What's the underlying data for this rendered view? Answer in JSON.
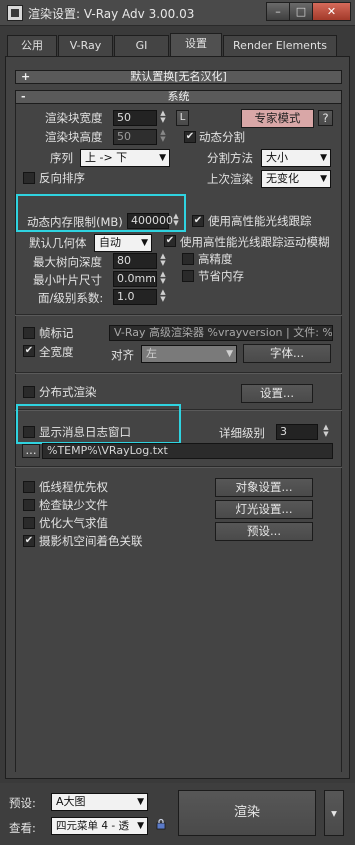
{
  "window": {
    "title": "渲染设置: V-Ray Adv 3.00.03",
    "minimize": "–",
    "maximize": "□",
    "close": "✕"
  },
  "tabs": [
    {
      "label": "公用"
    },
    {
      "label": "V-Ray"
    },
    {
      "label": "GI"
    },
    {
      "label": "设置"
    },
    {
      "label": "Render Elements"
    }
  ],
  "rollouts": {
    "default_replace": {
      "sign": "+",
      "title": "默认置换[无名汉化]"
    },
    "system": {
      "sign": "-",
      "title": "系统"
    }
  },
  "system": {
    "bucket_width_label": "渲染块宽度",
    "bucket_width_value": "50",
    "lock_label": "L",
    "expert_mode_label": "专家模式",
    "help_label": "?",
    "bucket_height_label": "渲染块高度",
    "bucket_height_value": "50",
    "dynamic_split_label": "动态分割",
    "sequence_label": "序列",
    "sequence_value": "上 -> 下",
    "split_method_label": "分割方法",
    "split_method_value": "大小",
    "reverse_order_label": "反向排序",
    "last_render_label": "上次渲染",
    "last_render_value": "无变化",
    "dynamic_memory_label": "动态内存限制(MB)",
    "dynamic_memory_value": "400000",
    "use_embree_label": "使用高性能光线跟踪",
    "default_geometry_label": "默认几何体",
    "default_geometry_value": "自动",
    "use_embree_motion_label": "使用高性能光线跟踪运动模糊",
    "max_tree_depth_label": "最大树向深度",
    "max_tree_depth_value": "80",
    "high_precision_label": "高精度",
    "min_leaf_size_label": "最小叶片尺寸",
    "min_leaf_size_value": "0.0mm",
    "save_memory_label": "节省内存",
    "face_level_coef_label": "面/级别系数:",
    "face_level_coef_value": "1.0",
    "frame_stamp_label": "帧标记",
    "frame_stamp_text": "V-Ray 高级渲染器 %vrayversion | 文件: %f",
    "full_width_label": "全宽度",
    "align_label": "对齐",
    "align_value": "左",
    "font_button": "字体...",
    "distributed_label": "分布式渲染",
    "distributed_settings_button": "设置...",
    "show_log_label": "显示消息日志窗口",
    "verbose_level_label": "详细级别",
    "verbose_level_value": "3",
    "log_browse": "...",
    "log_path": "%TEMP%\\VRayLog.txt",
    "low_thread_priority_label": "低线程优先权",
    "check_missing_files_label": "检查缺少文件",
    "optimize_atmo_label": "优化大气求值",
    "camera_space_shading_label": "摄影机空间着色关联",
    "object_settings_button": "对象设置...",
    "light_settings_button": "灯光设置...",
    "presets_button": "预设..."
  },
  "bottom": {
    "preset_label": "预设:",
    "preset_value": "A大图",
    "view_label": "查看:",
    "view_value": "四元菜单 4 - 透",
    "render_button": "渲染",
    "lock_icon": "lock-icon",
    "more_arrow": "▾"
  },
  "colors": {
    "highlight": "#2fd3e0",
    "expert_button": "#d9a7a7"
  }
}
